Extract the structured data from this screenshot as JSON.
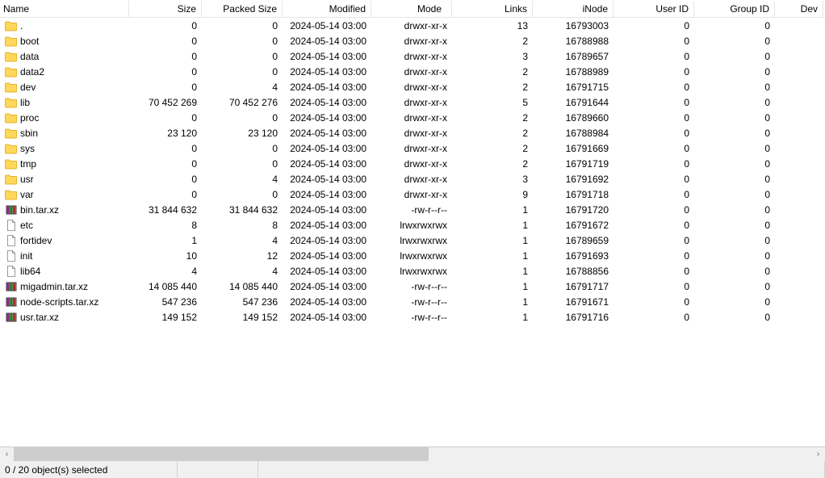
{
  "columns": {
    "name": "Name",
    "size": "Size",
    "packed": "Packed Size",
    "modified": "Modified",
    "mode": "Mode",
    "links": "Links",
    "inode": "iNode",
    "userid": "User ID",
    "groupid": "Group ID",
    "dev": "Dev"
  },
  "rows": [
    {
      "icon": "folder",
      "name": ".",
      "size": "0",
      "packed": "0",
      "modified": "2024-05-14 03:00",
      "mode": "drwxr-xr-x",
      "links": "13",
      "inode": "16793003",
      "userid": "0",
      "groupid": "0"
    },
    {
      "icon": "folder",
      "name": "boot",
      "size": "0",
      "packed": "0",
      "modified": "2024-05-14 03:00",
      "mode": "drwxr-xr-x",
      "links": "2",
      "inode": "16788988",
      "userid": "0",
      "groupid": "0"
    },
    {
      "icon": "folder",
      "name": "data",
      "size": "0",
      "packed": "0",
      "modified": "2024-05-14 03:00",
      "mode": "drwxr-xr-x",
      "links": "3",
      "inode": "16789657",
      "userid": "0",
      "groupid": "0"
    },
    {
      "icon": "folder",
      "name": "data2",
      "size": "0",
      "packed": "0",
      "modified": "2024-05-14 03:00",
      "mode": "drwxr-xr-x",
      "links": "2",
      "inode": "16788989",
      "userid": "0",
      "groupid": "0"
    },
    {
      "icon": "folder",
      "name": "dev",
      "size": "0",
      "packed": "4",
      "modified": "2024-05-14 03:00",
      "mode": "drwxr-xr-x",
      "links": "2",
      "inode": "16791715",
      "userid": "0",
      "groupid": "0"
    },
    {
      "icon": "folder",
      "name": "lib",
      "size": "70 452 269",
      "packed": "70 452 276",
      "modified": "2024-05-14 03:00",
      "mode": "drwxr-xr-x",
      "links": "5",
      "inode": "16791644",
      "userid": "0",
      "groupid": "0"
    },
    {
      "icon": "folder",
      "name": "proc",
      "size": "0",
      "packed": "0",
      "modified": "2024-05-14 03:00",
      "mode": "drwxr-xr-x",
      "links": "2",
      "inode": "16789660",
      "userid": "0",
      "groupid": "0"
    },
    {
      "icon": "folder",
      "name": "sbin",
      "size": "23 120",
      "packed": "23 120",
      "modified": "2024-05-14 03:00",
      "mode": "drwxr-xr-x",
      "links": "2",
      "inode": "16788984",
      "userid": "0",
      "groupid": "0"
    },
    {
      "icon": "folder",
      "name": "sys",
      "size": "0",
      "packed": "0",
      "modified": "2024-05-14 03:00",
      "mode": "drwxr-xr-x",
      "links": "2",
      "inode": "16791669",
      "userid": "0",
      "groupid": "0"
    },
    {
      "icon": "folder",
      "name": "tmp",
      "size": "0",
      "packed": "0",
      "modified": "2024-05-14 03:00",
      "mode": "drwxr-xr-x",
      "links": "2",
      "inode": "16791719",
      "userid": "0",
      "groupid": "0"
    },
    {
      "icon": "folder",
      "name": "usr",
      "size": "0",
      "packed": "4",
      "modified": "2024-05-14 03:00",
      "mode": "drwxr-xr-x",
      "links": "3",
      "inode": "16791692",
      "userid": "0",
      "groupid": "0"
    },
    {
      "icon": "folder",
      "name": "var",
      "size": "0",
      "packed": "0",
      "modified": "2024-05-14 03:00",
      "mode": "drwxr-xr-x",
      "links": "9",
      "inode": "16791718",
      "userid": "0",
      "groupid": "0"
    },
    {
      "icon": "archive",
      "name": "bin.tar.xz",
      "size": "31 844 632",
      "packed": "31 844 632",
      "modified": "2024-05-14 03:00",
      "mode": "-rw-r--r--",
      "links": "1",
      "inode": "16791720",
      "userid": "0",
      "groupid": "0"
    },
    {
      "icon": "file",
      "name": "etc",
      "size": "8",
      "packed": "8",
      "modified": "2024-05-14 03:00",
      "mode": "lrwxrwxrwx",
      "links": "1",
      "inode": "16791672",
      "userid": "0",
      "groupid": "0"
    },
    {
      "icon": "file",
      "name": "fortidev",
      "size": "1",
      "packed": "4",
      "modified": "2024-05-14 03:00",
      "mode": "lrwxrwxrwx",
      "links": "1",
      "inode": "16789659",
      "userid": "0",
      "groupid": "0"
    },
    {
      "icon": "file",
      "name": "init",
      "size": "10",
      "packed": "12",
      "modified": "2024-05-14 03:00",
      "mode": "lrwxrwxrwx",
      "links": "1",
      "inode": "16791693",
      "userid": "0",
      "groupid": "0"
    },
    {
      "icon": "file",
      "name": "lib64",
      "size": "4",
      "packed": "4",
      "modified": "2024-05-14 03:00",
      "mode": "lrwxrwxrwx",
      "links": "1",
      "inode": "16788856",
      "userid": "0",
      "groupid": "0"
    },
    {
      "icon": "archive",
      "name": "migadmin.tar.xz",
      "size": "14 085 440",
      "packed": "14 085 440",
      "modified": "2024-05-14 03:00",
      "mode": "-rw-r--r--",
      "links": "1",
      "inode": "16791717",
      "userid": "0",
      "groupid": "0"
    },
    {
      "icon": "archive",
      "name": "node-scripts.tar.xz",
      "size": "547 236",
      "packed": "547 236",
      "modified": "2024-05-14 03:00",
      "mode": "-rw-r--r--",
      "links": "1",
      "inode": "16791671",
      "userid": "0",
      "groupid": "0"
    },
    {
      "icon": "archive",
      "name": "usr.tar.xz",
      "size": "149 152",
      "packed": "149 152",
      "modified": "2024-05-14 03:00",
      "mode": "-rw-r--r--",
      "links": "1",
      "inode": "16791716",
      "userid": "0",
      "groupid": "0"
    }
  ],
  "status": {
    "selection": "0 / 20 object(s) selected"
  },
  "icon_glyphs": {
    "scroll_left": "‹",
    "scroll_right": "›"
  }
}
